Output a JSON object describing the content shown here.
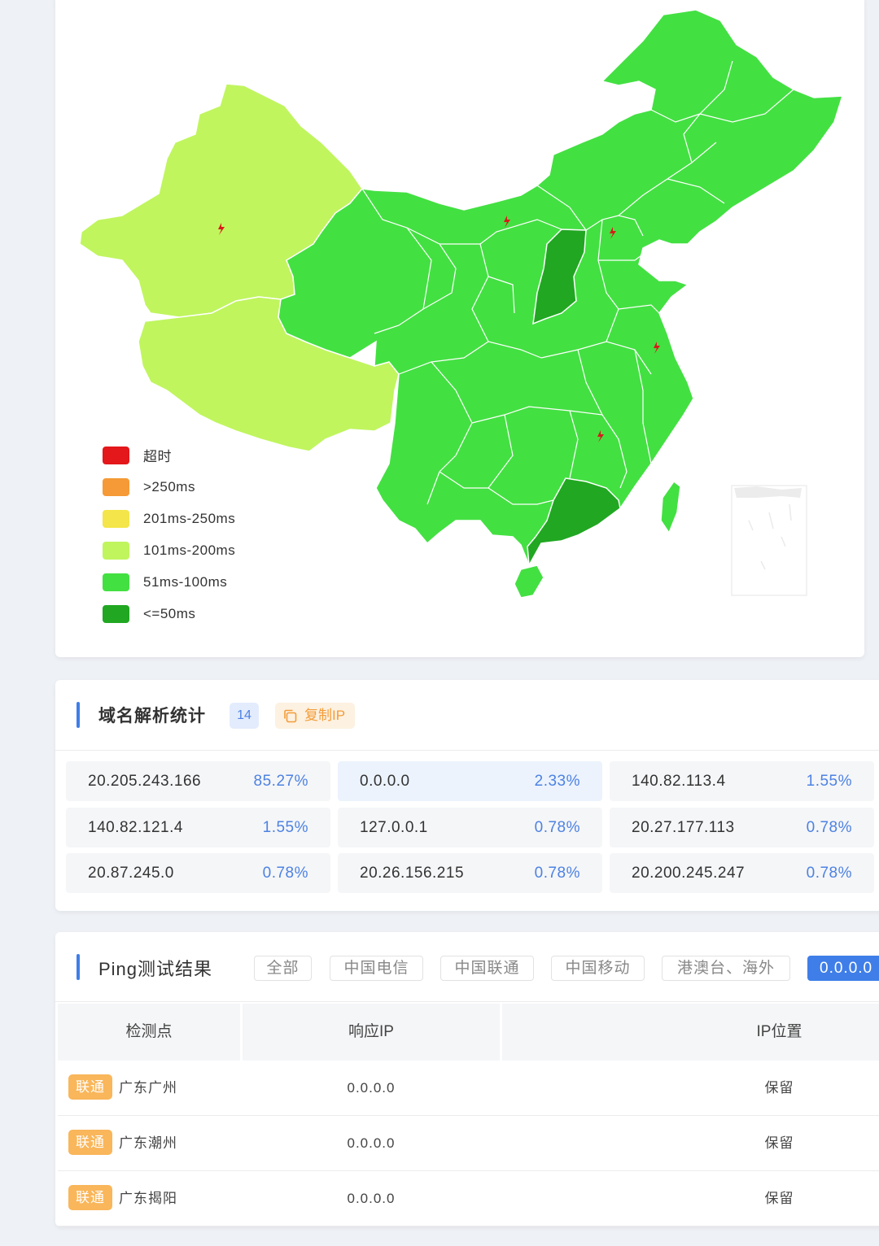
{
  "colors": {
    "accent": "#3f7ee8",
    "timeout": "#e4171a",
    "gt250": "#f59a36",
    "201_250": "#f4e54a",
    "101_200": "#c0f55e",
    "51_100": "#43e042",
    "le50": "#21a722"
  },
  "map": {
    "legend": [
      {
        "label": "超时",
        "color": "#e4171a"
      },
      {
        "label": ">250ms",
        "color": "#f59a36"
      },
      {
        "label": "201ms-250ms",
        "color": "#f4e54a"
      },
      {
        "label": "101ms-200ms",
        "color": "#c0f55e"
      },
      {
        "label": "51ms-100ms",
        "color": "#43e042"
      },
      {
        "label": "<=50ms",
        "color": "#21a722"
      }
    ],
    "marker_icon": "lightning-icon"
  },
  "dns": {
    "title": "域名解析统计",
    "count": "14",
    "copy_label": "复制IP",
    "copy_icon": "copy-icon",
    "items": [
      {
        "ip": "20.205.243.166",
        "pct": "85.27%"
      },
      {
        "ip": "0.0.0.0",
        "pct": "2.33%"
      },
      {
        "ip": "140.82.113.4",
        "pct": "1.55%"
      },
      {
        "ip": "140.82.121.4",
        "pct": "1.55%"
      },
      {
        "ip": "127.0.0.1",
        "pct": "0.78%"
      },
      {
        "ip": "20.27.177.113",
        "pct": "0.78%"
      },
      {
        "ip": "20.87.245.0",
        "pct": "0.78%"
      },
      {
        "ip": "20.26.156.215",
        "pct": "0.78%"
      },
      {
        "ip": "20.200.245.247",
        "pct": "0.78%"
      }
    ]
  },
  "ping": {
    "title": "Ping测试结果",
    "tabs": [
      "全部",
      "中国电信",
      "中国联通",
      "中国移动",
      "港澳台、海外",
      "0.0.0.0"
    ],
    "active_tab": "0.0.0.0",
    "headers": [
      "检测点",
      "响应IP",
      "IP位置"
    ],
    "rows": [
      {
        "isp": "联通",
        "location": "广东广州",
        "ip": "0.0.0.0",
        "ip_location": "保留"
      },
      {
        "isp": "联通",
        "location": "广东潮州",
        "ip": "0.0.0.0",
        "ip_location": "保留"
      },
      {
        "isp": "联通",
        "location": "广东揭阳",
        "ip": "0.0.0.0",
        "ip_location": "保留"
      }
    ]
  }
}
